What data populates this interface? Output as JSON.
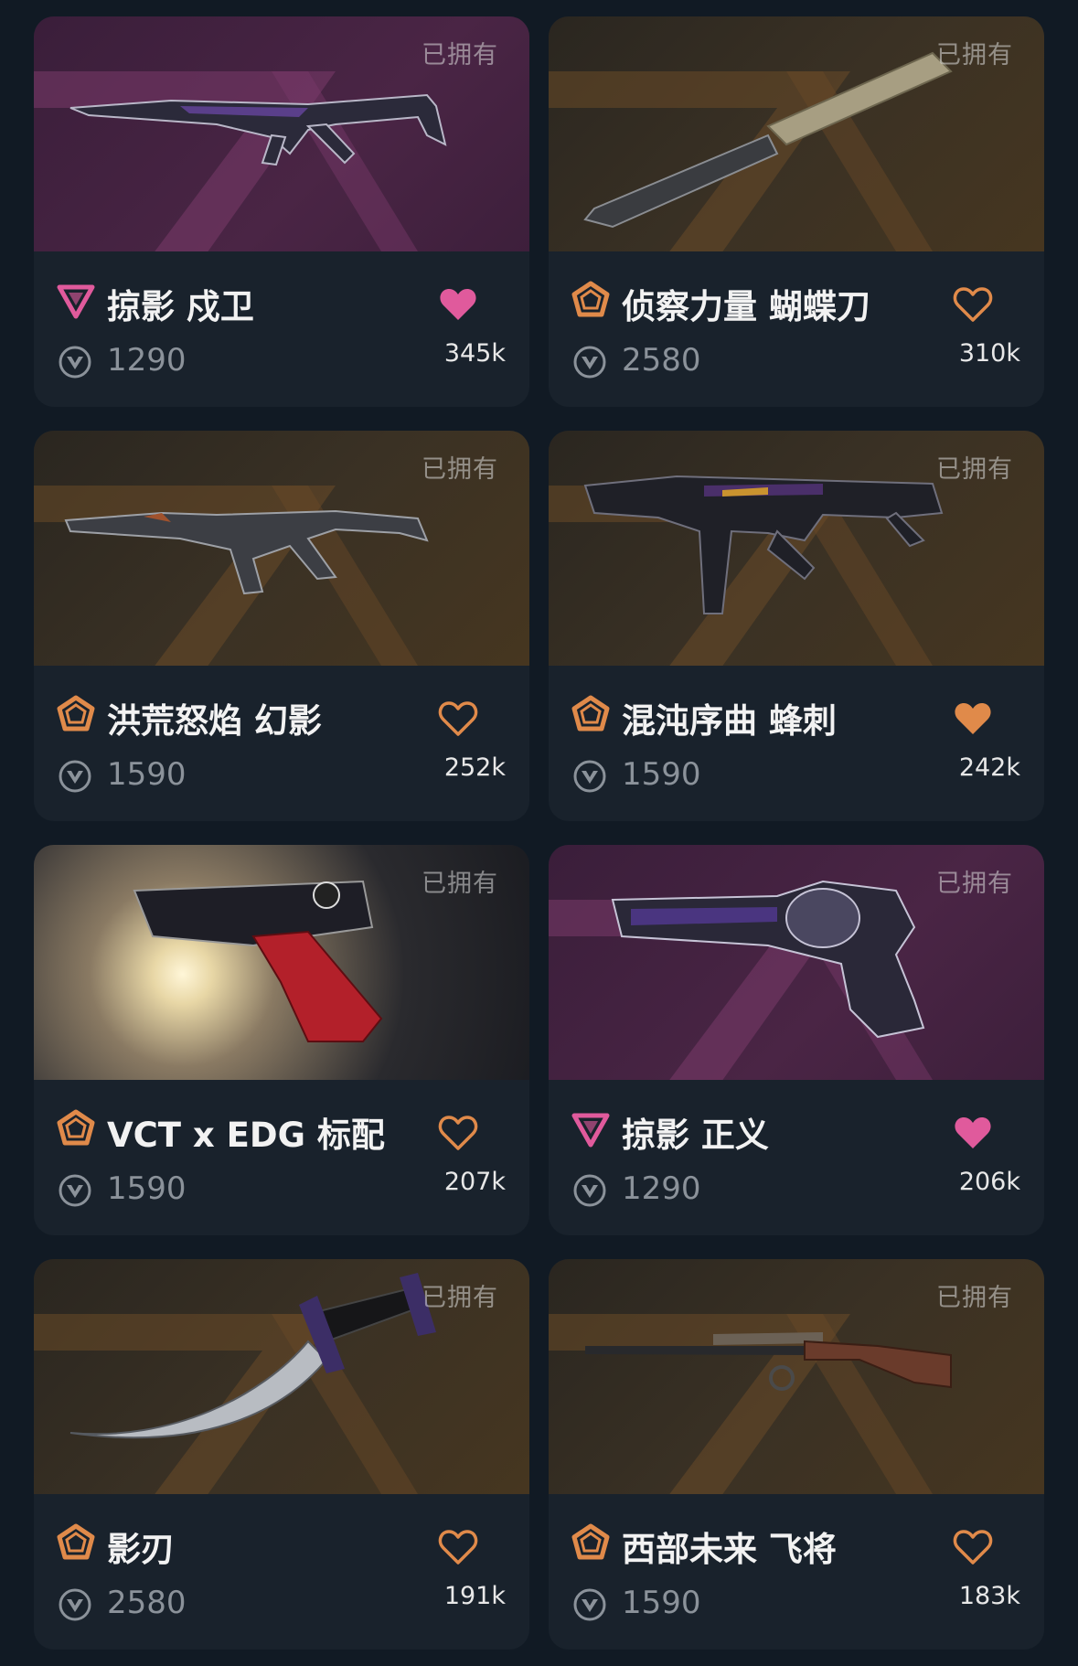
{
  "owned_label": "已拥有",
  "colors": {
    "premium_pink": "#e05a9c",
    "select_orange": "#e08a4a"
  },
  "cards": [
    {
      "name": "掠影 戍卫",
      "price": "1290",
      "likes": "345k",
      "tier": "premium",
      "liked": true,
      "weapon_icon": "vandal-rifle-icon"
    },
    {
      "name": "侦察力量 蝴蝶刀",
      "price": "2580",
      "likes": "310k",
      "tier": "select",
      "liked": false,
      "weapon_icon": "butterfly-knife-icon"
    },
    {
      "name": "洪荒怒焰 幻影",
      "price": "1590",
      "likes": "252k",
      "tier": "select",
      "liked": false,
      "weapon_icon": "phantom-rifle-icon"
    },
    {
      "name": "混沌序曲 蜂刺",
      "price": "1590",
      "likes": "242k",
      "tier": "select",
      "liked": true,
      "weapon_icon": "spectre-smg-icon"
    },
    {
      "name": "VCT x EDG 标配",
      "price": "1590",
      "likes": "207k",
      "tier": "select",
      "liked": false,
      "weapon_icon": "classic-pistol-icon"
    },
    {
      "name": "掠影 正义",
      "price": "1290",
      "likes": "206k",
      "tier": "premium",
      "liked": true,
      "weapon_icon": "sheriff-revolver-icon"
    },
    {
      "name": "影刃",
      "price": "2580",
      "likes": "191k",
      "tier": "select",
      "liked": false,
      "weapon_icon": "knife-icon"
    },
    {
      "name": "西部未来 飞将",
      "price": "1590",
      "likes": "183k",
      "tier": "select",
      "liked": false,
      "weapon_icon": "marshal-sniper-icon"
    }
  ]
}
